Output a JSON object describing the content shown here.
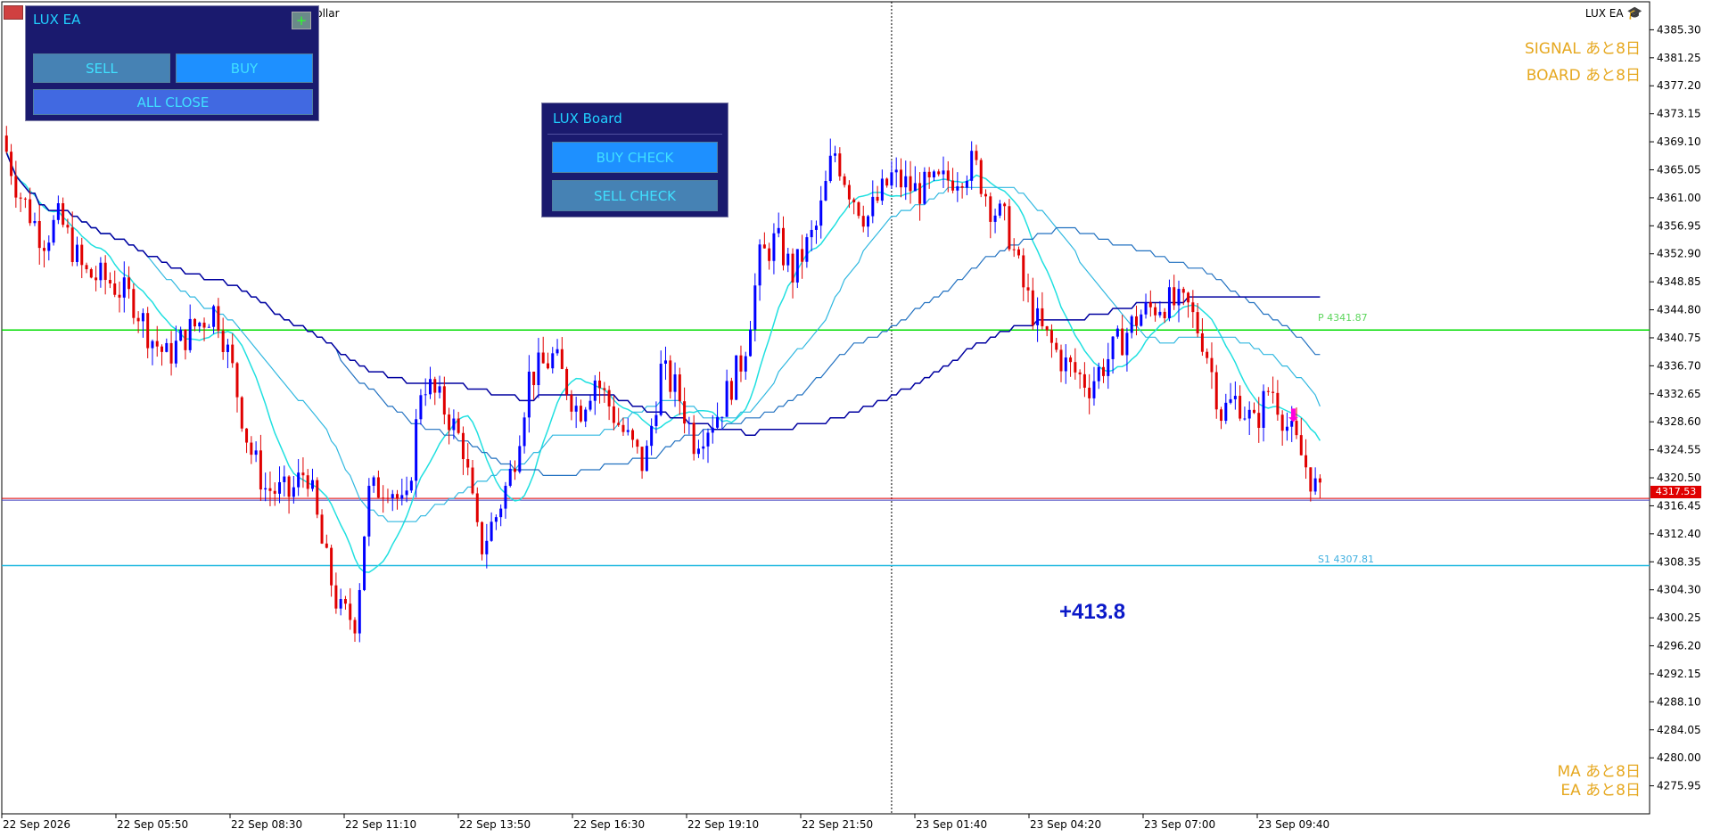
{
  "window": {
    "symbol_label": "Dollar",
    "brand": "LUX EA",
    "brand_icon": "graduation-cap-icon"
  },
  "lux_ea_panel": {
    "title": "LUX EA",
    "expand_symbol": "+",
    "sell_label": "SELL",
    "buy_label": "BUY",
    "all_close_label": "ALL CLOSE"
  },
  "lux_board_panel": {
    "title": "LUX Board",
    "buy_check_label": "BUY CHECK",
    "sell_check_label": "SELL CHECK"
  },
  "status": {
    "signal": "SIGNAL あと8日",
    "board": "BOARD あと8日",
    "ma": "MA あと8日",
    "ea": "EA あと8日",
    "profit": "+413.8"
  },
  "levels": {
    "current_price": "4317.53",
    "p_label": "P 4341.87",
    "s1_label": "S1 4307.81"
  },
  "colors": {
    "bull_candle": "#0000ff",
    "bear_candle": "#e00000",
    "green_line": "#00dd00",
    "s1_line": "#20b8e0",
    "price_line": "#e00000",
    "ma_fast": "#20e0e0",
    "profit": "#0a18c8",
    "status_orange": "#e6a820",
    "panel_bg": "#1a1a6e"
  },
  "chart_data": {
    "type": "candlestick",
    "y_axis": {
      "range": [
        4271.9,
        4389.35
      ],
      "ticks": [
        "4385.30",
        "4381.25",
        "4377.20",
        "4373.15",
        "4369.10",
        "4365.05",
        "4361.00",
        "4356.95",
        "4352.90",
        "4348.85",
        "4344.80",
        "4340.75",
        "4336.70",
        "4332.65",
        "4328.60",
        "4324.55",
        "4320.50",
        "4316.45",
        "4312.40",
        "4308.35",
        "4304.30",
        "4300.25",
        "4296.20",
        "4292.15",
        "4288.10",
        "4284.05",
        "4280.00",
        "4275.95"
      ]
    },
    "x_axis": {
      "ticks": [
        "22 Sep 2026",
        "22 Sep 05:50",
        "22 Sep 08:30",
        "22 Sep 11:10",
        "22 Sep 13:50",
        "22 Sep 16:30",
        "22 Sep 19:10",
        "22 Sep 21:50",
        "23 Sep 01:40",
        "23 Sep 04:20",
        "23 Sep 07:00",
        "23 Sep 09:40"
      ]
    },
    "horizontal_lines": {
      "pivot": 4341.87,
      "s1": 4307.81,
      "current": 4317.53
    },
    "price_path": [
      {
        "t": 0,
        "p": 4370
      },
      {
        "t": 0.01,
        "p": 4362
      },
      {
        "t": 0.025,
        "p": 4355
      },
      {
        "t": 0.035,
        "p": 4358
      },
      {
        "t": 0.05,
        "p": 4350
      },
      {
        "t": 0.065,
        "p": 4349
      },
      {
        "t": 0.08,
        "p": 4346
      },
      {
        "t": 0.09,
        "p": 4341
      },
      {
        "t": 0.1,
        "p": 4338
      },
      {
        "t": 0.115,
        "p": 4342
      },
      {
        "t": 0.13,
        "p": 4345
      },
      {
        "t": 0.14,
        "p": 4336
      },
      {
        "t": 0.15,
        "p": 4325
      },
      {
        "t": 0.16,
        "p": 4319
      },
      {
        "t": 0.175,
        "p": 4318
      },
      {
        "t": 0.185,
        "p": 4322
      },
      {
        "t": 0.195,
        "p": 4310
      },
      {
        "t": 0.205,
        "p": 4301
      },
      {
        "t": 0.215,
        "p": 4300
      },
      {
        "t": 0.222,
        "p": 4318
      },
      {
        "t": 0.235,
        "p": 4320
      },
      {
        "t": 0.245,
        "p": 4315
      },
      {
        "t": 0.255,
        "p": 4335
      },
      {
        "t": 0.27,
        "p": 4330
      },
      {
        "t": 0.28,
        "p": 4325
      },
      {
        "t": 0.29,
        "p": 4310
      },
      {
        "t": 0.3,
        "p": 4315
      },
      {
        "t": 0.31,
        "p": 4322
      },
      {
        "t": 0.32,
        "p": 4335
      },
      {
        "t": 0.335,
        "p": 4338
      },
      {
        "t": 0.35,
        "p": 4330
      },
      {
        "t": 0.36,
        "p": 4335
      },
      {
        "t": 0.375,
        "p": 4328
      },
      {
        "t": 0.39,
        "p": 4322
      },
      {
        "t": 0.4,
        "p": 4336
      },
      {
        "t": 0.41,
        "p": 4333
      },
      {
        "t": 0.42,
        "p": 4326
      },
      {
        "t": 0.435,
        "p": 4330
      },
      {
        "t": 0.45,
        "p": 4338
      },
      {
        "t": 0.46,
        "p": 4352
      },
      {
        "t": 0.47,
        "p": 4355
      },
      {
        "t": 0.48,
        "p": 4350
      },
      {
        "t": 0.495,
        "p": 4357
      },
      {
        "t": 0.505,
        "p": 4368
      },
      {
        "t": 0.515,
        "p": 4362
      },
      {
        "t": 0.525,
        "p": 4358
      },
      {
        "t": 0.54,
        "p": 4364
      },
      {
        "t": 0.555,
        "p": 4362
      },
      {
        "t": 0.57,
        "p": 4363
      },
      {
        "t": 0.59,
        "p": 4366
      },
      {
        "t": 0.6,
        "p": 4360
      },
      {
        "t": 0.61,
        "p": 4357
      },
      {
        "t": 0.62,
        "p": 4348
      },
      {
        "t": 0.63,
        "p": 4342
      },
      {
        "t": 0.645,
        "p": 4337
      },
      {
        "t": 0.66,
        "p": 4334
      },
      {
        "t": 0.675,
        "p": 4339
      },
      {
        "t": 0.69,
        "p": 4344
      },
      {
        "t": 0.705,
        "p": 4346
      },
      {
        "t": 0.72,
        "p": 4345
      },
      {
        "t": 0.73,
        "p": 4340
      },
      {
        "t": 0.74,
        "p": 4330
      },
      {
        "t": 0.75,
        "p": 4332
      },
      {
        "t": 0.76,
        "p": 4328
      },
      {
        "t": 0.77,
        "p": 4334
      },
      {
        "t": 0.78,
        "p": 4328
      },
      {
        "t": 0.79,
        "p": 4323
      },
      {
        "t": 0.8,
        "p": 4317.5
      }
    ]
  }
}
